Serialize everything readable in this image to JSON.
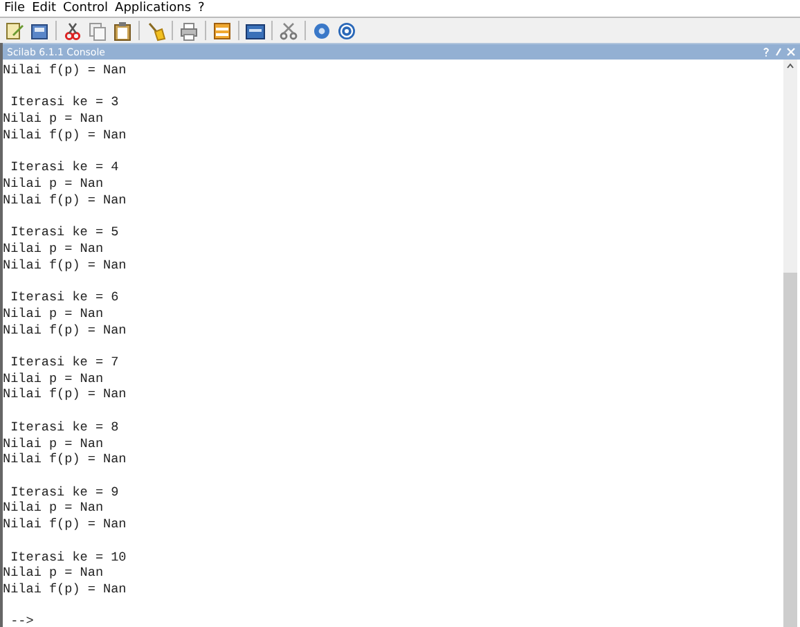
{
  "menu": [
    "File",
    "Edit",
    "Control",
    "Applications",
    "?"
  ],
  "console": {
    "title": "Scilab 6.1.1 Console",
    "first_line": "Nilai f(p) = Nan",
    "iterations": [
      {
        "heading": "Iterasi ke = 3",
        "lines": [
          "Nilai p = Nan",
          "Nilai f(p) = Nan"
        ]
      },
      {
        "heading": "Iterasi ke = 4",
        "lines": [
          "Nilai p = Nan",
          "Nilai f(p) = Nan"
        ]
      },
      {
        "heading": "Iterasi ke = 5",
        "lines": [
          "Nilai p = Nan",
          "Nilai f(p) = Nan"
        ]
      },
      {
        "heading": "Iterasi ke = 6",
        "lines": [
          "Nilai p = Nan",
          "Nilai f(p) = Nan"
        ]
      },
      {
        "heading": "Iterasi ke = 7",
        "lines": [
          "Nilai p = Nan",
          "Nilai f(p) = Nan"
        ]
      },
      {
        "heading": "Iterasi ke = 8",
        "lines": [
          "Nilai p = Nan",
          "Nilai f(p) = Nan"
        ]
      },
      {
        "heading": "Iterasi ke = 9",
        "lines": [
          "Nilai p = Nan",
          "Nilai f(p) = Nan"
        ]
      },
      {
        "heading": "Iterasi ke = 10",
        "lines": [
          "Nilai p = Nan",
          "Nilai f(p) = Nan"
        ]
      }
    ],
    "prompt": "-->"
  }
}
